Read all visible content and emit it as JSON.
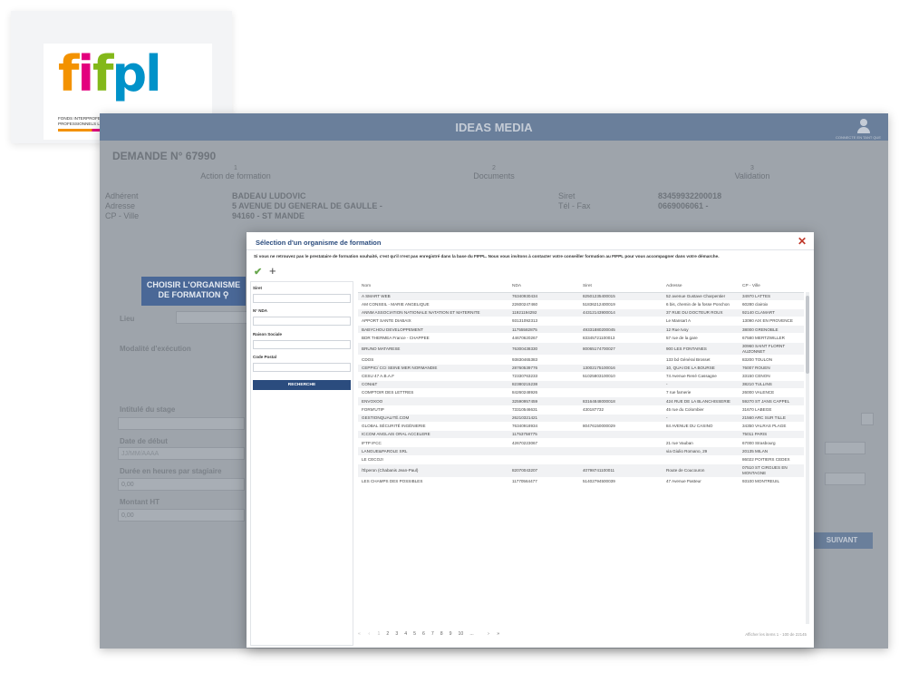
{
  "logo": {
    "word": {
      "f": "f",
      "i": "i",
      "f2": "f",
      "p": "p",
      "l": "l"
    },
    "subtitle": "FONDS INTERPROFESSIONNEL DE FORMATION DES PROFESSIONNELS LIBÉRAUX"
  },
  "app": {
    "title": "IDEAS MEDIA",
    "user_label": "CONNECTE EN TANT QUE",
    "demande": "DEMANDE N° 67990",
    "steps": [
      {
        "n": "1",
        "label": "Action de formation"
      },
      {
        "n": "2",
        "label": "Documents"
      },
      {
        "n": "3",
        "label": "Validation"
      }
    ],
    "info": {
      "adherent_label": "Adhérent",
      "adherent_value": "BADEAU LUDOVIC",
      "adresse_label": "Adresse",
      "adresse_value": "5 AVENUE DU GENERAL DE GAULLE -",
      "cpville_label": "CP - Ville",
      "cpville_value": "94160 - ST MANDE",
      "siret_label": "Siret",
      "siret_value": "83459932200018",
      "tel_label": "Tél - Fax",
      "tel_value": "0669006061 -"
    },
    "choose_button": "CHOISIR L'ORGANISME DE FORMATION",
    "fields": {
      "lieu": "Lieu",
      "modalite": "Modalité d'exécution",
      "intitule": "Intitulé du stage",
      "date_debut": "Date de début",
      "date_debut_placeholder": "JJ/MM/AAAA",
      "duree": "Durée en heures par stagiaire",
      "duree_value": "0,00",
      "montant": "Montant HT",
      "montant_value": "0,00"
    },
    "suivant": "SUIVANT"
  },
  "modal": {
    "title": "Sélection d'un organisme de formation",
    "close": "✕",
    "notice": "Si vous ne retrouvez pas le prestataire de formation souhaité, c'est qu'il n'est pas enregistré dans la base du FIFPL. Nous vous invitons à contacter votre conseiller formation au FIFPL pour vous accompagner dans votre démarche.",
    "toolbar": {
      "validate": "✔",
      "add": "+"
    },
    "filters": {
      "siret": "Siret",
      "nda": "N° NDA",
      "raison": "Raison Sociale",
      "code_postal": "Code Postal",
      "search_button": "RECHERCHE"
    },
    "columns": [
      "Nom",
      "NDA",
      "Siret",
      "Adresse",
      "CP - Ville"
    ],
    "rows": [
      [
        "A SMART WEB",
        "76340930434",
        "82501235400015",
        "52 avenue Gustave Charpentier",
        "34970 LATTES"
      ],
      [
        "AM CONSEIL - MARIE ANGELIQUE",
        "22600247460",
        "51836212400019",
        "6 bis, chemin de la fosse Ponchon",
        "60280 clairoix"
      ],
      [
        "ANNM ASSOCIATION NATIONALE NATATION ET MATERNITE",
        "11921194292",
        "44312143900014",
        "37 RUE DU DOCTEUR ROUX",
        "92140 CLAMART"
      ],
      [
        "APPORT SANTE DIABAIX",
        "93131092313",
        "",
        "Le Mansart A",
        "13090 AIX EN PROVENCE"
      ],
      [
        "BABYCHOU DEVELOPPEMENT",
        "11755582875",
        "49331880200045",
        "12 Rue Ivoy",
        "38000 GRENOBLE"
      ],
      [
        "BDR THERMEA France - CHAPPEE",
        "44670620267",
        "83345721100013",
        "57 rue de la gare",
        "67580 MERTZWILLER"
      ],
      [
        "BRUNO MATARESE",
        "76300438330",
        "80065174700027",
        "900 LES FONTAINES",
        "30960 SAINT FLORNT AUZONNET"
      ],
      [
        "CDOS",
        "93830465383",
        "",
        "133 bd Général Brosset",
        "83200 TOULON"
      ],
      [
        "CEPPIC/ CCI SEINE MER NORMANDIE",
        "28760539776",
        "13002175100016",
        "10, QUAI DE LA BOURSE",
        "76007 ROUEN"
      ],
      [
        "CESU 47 A.B.A.F",
        "72330763233",
        "51025803100010",
        "74 Avenue René Cassagne",
        "33150 CENON"
      ],
      [
        "CONI&T",
        "82380215238",
        "",
        "-",
        "38210 TULLINS"
      ],
      [
        "COMPTOIR DES LETTRES",
        "84260248926",
        "",
        "7 rue farnerie",
        "26000 VALENCE"
      ],
      [
        "ENVOXOO",
        "32590957459",
        "83164848000018",
        "424 RUE DE LA BLANCHISSERIE",
        "59270 ST JANS CAPPEL"
      ],
      [
        "FORM'UTIP",
        "73310546631",
        "430187732",
        "45 rue du Colombier",
        "31670 LABEGE"
      ],
      [
        "GESTIONQUALITÉ.COM",
        "26210321421",
        "",
        "-",
        "21560 ARC SUR TILLE"
      ],
      [
        "GLOBAL SÉCURITÉ INGÉNIERIE",
        "76340918934",
        "80476150000029",
        "84 AVENUE DU CASINO",
        "34350 VALRAS PLAGE"
      ],
      [
        "ICCOM ANGLAIS ORAL ACCELERE",
        "11753758775",
        "",
        "",
        "75011 PARIS"
      ],
      [
        "IFTP IFCC",
        "42670223067",
        "",
        "21 rue Vauban",
        "67000 Strasbourg"
      ],
      [
        "LANGUE&PAROLE SRL",
        "",
        "",
        "via Giulio Romano, 29",
        "20135 MILAN"
      ],
      [
        "LE CECOJI",
        "",
        "",
        "",
        "86022 POITIERS CEDEX"
      ],
      [
        "l'Éperon (Chabanis Jean-Paul)",
        "82070043207",
        "40798741100011",
        "Route de Coucouron",
        "07510 ST CIRGUES EN MONTAGNE"
      ],
      [
        "LES CHAMPS DES POSSIBLES",
        "11770564477",
        "51402794500039",
        "47 Avenue Pasteur",
        "93100 MONTREUIL"
      ]
    ],
    "pager": {
      "first": "«",
      "prev": "‹",
      "pages": [
        "1",
        "2",
        "3",
        "4",
        "5",
        "6",
        "7",
        "8",
        "9",
        "10",
        "..."
      ],
      "next": "›",
      "last": "»",
      "info": "Afficher les items 1 - 100 de 22145"
    }
  },
  "colors": {
    "brand_blue": "#2b4c7e",
    "close_red": "#c0392b",
    "check_green": "#6aa84f"
  }
}
